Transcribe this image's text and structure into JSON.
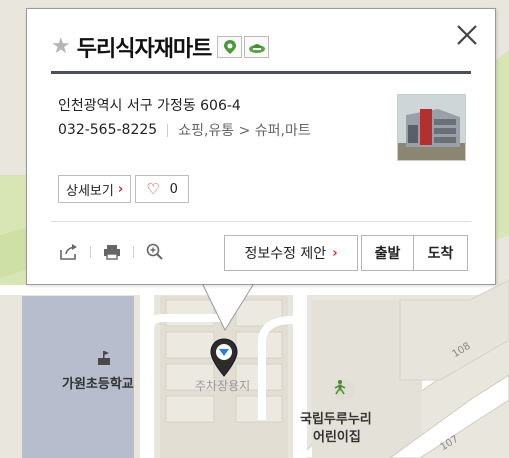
{
  "popup": {
    "title": "두리식자재마트",
    "address": "인천광역시 서구 가정동 606-4",
    "phone": "032-565-8225",
    "category": "쇼핑,유통 > 슈퍼,마트",
    "detail_button": "상세보기",
    "like_count": "0",
    "suggest_edit_button": "정보수정 제안",
    "departure_button": "출발",
    "arrival_button": "도착",
    "icons": [
      "star-icon",
      "parking-icon",
      "mart-icon",
      "close-icon",
      "share-icon",
      "print-icon",
      "zoom-icon",
      "heart-icon",
      "chevron-right-icon"
    ],
    "accent_color": "#e0262b"
  },
  "map": {
    "labels": {
      "school": "가원초등학교",
      "parking": "주차장용지",
      "kindergarten_line1": "국립두루누리",
      "kindergarten_line2": "어린이집"
    },
    "road_numbers": {
      "r108": "108",
      "r107": "107"
    }
  }
}
